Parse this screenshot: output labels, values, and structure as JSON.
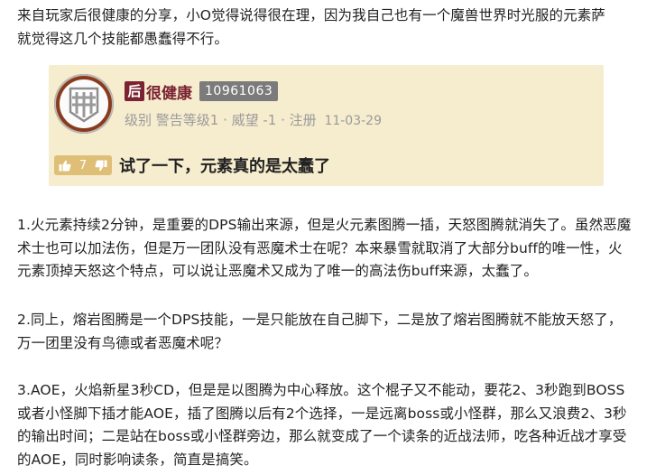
{
  "intro": {
    "lines": [
      "来自玩家后很健康的分享，小O觉得说得很在理，因为我自己也有一个魔兽世界时光服的元素萨",
      "就觉得这几个技能都愚蠢得不行。"
    ]
  },
  "quote": {
    "avatar_icon": "portcullis-helmet-icon",
    "rank_badge": "后",
    "username": "很健康",
    "uid": "10961063",
    "meta": "级别  警告等级1 · 威望 -1 · 注册",
    "date": "11-03-29",
    "likes": "7",
    "title": "试了一下，元素真的是太蠢了",
    "colors": {
      "card_bg": "#f6ecce",
      "name": "#7a2332",
      "badge": "#7b7b7b",
      "like_pill": "#dfbf76"
    }
  },
  "paragraphs": [
    {
      "lines": [
        "1.火元素持续2分钟，是重要的DPS输出来源，但是火元素图腾一插，天怒图腾就消失了。虽然恶魔",
        "术士也可以加法伤，但是万一团队没有恶魔术士在呢？本来暴雪就取消了大部分buff的唯一性，火",
        "元素顶掉天怒这个特点，可以说让恶魔术又成为了唯一的高法伤buff来源，太蠢了。"
      ]
    },
    {
      "lines": [
        "2.同上，熔岩图腾是一个DPS技能，一是只能放在自己脚下，二是放了熔岩图腾就不能放天怒了，",
        "万一团里没有鸟德或者恶魔术呢？"
      ]
    },
    {
      "lines": [
        "3.AOE，火焰新星3秒CD，但是是以图腾为中心释放。这个棍子又不能动，要花2、3秒跑到BOSS",
        "或者小怪脚下插才能AOE，插了图腾以后有2个选择，一是远离boss或小怪群，那么又浪费2、3秒",
        "的输出时间；二是站在boss或小怪群旁边，那么就变成了一个读条的近战法师，吃各种近战才享受",
        "的AOE，同时影响读条，简直是搞笑。"
      ]
    }
  ]
}
